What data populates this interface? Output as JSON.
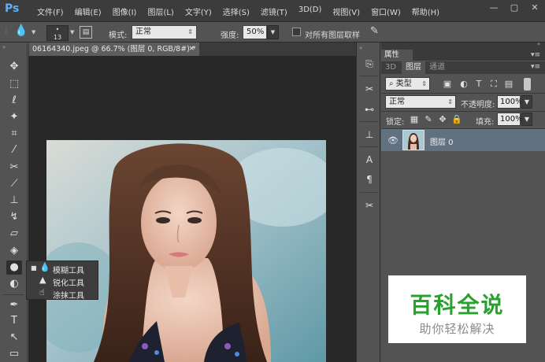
{
  "app": {
    "logo": "Ps"
  },
  "menu": [
    "文件(F)",
    "编辑(E)",
    "图像(I)",
    "图层(L)",
    "文字(Y)",
    "选择(S)",
    "滤镜(T)",
    "3D(D)",
    "视图(V)",
    "窗口(W)",
    "帮助(H)"
  ],
  "window_controls": {
    "minimize": "—",
    "restore": "▢",
    "close": "✕"
  },
  "options": {
    "brush_size": "13",
    "mode_label": "模式:",
    "mode_value": "正常",
    "strength_label": "强度:",
    "strength_value": "50%",
    "sample_all_label": "对所有图层取样"
  },
  "document": {
    "tab_title": "06164340.jpeg @ 66.7% (图层 0, RGB/8#) *",
    "close": "×"
  },
  "flyout": {
    "items": [
      {
        "label": "模糊工具",
        "icon": "blur-drop-icon",
        "selected": true
      },
      {
        "label": "锐化工具",
        "icon": "sharpen-triangle-icon",
        "selected": false
      },
      {
        "label": "涂抹工具",
        "icon": "smudge-finger-icon",
        "selected": false
      }
    ]
  },
  "panels": {
    "properties_tab": "属性",
    "tabs": [
      "3D",
      "图层",
      "通道"
    ],
    "active_tab": "图层",
    "filter_kind": "类型",
    "blend_mode": "正常",
    "opacity_label": "不透明度:",
    "opacity_value": "100%",
    "lock_label": "锁定:",
    "fill_label": "填充:",
    "fill_value": "100%",
    "layer_name": "图层 0"
  },
  "watermark": {
    "title": "百科全说",
    "subtitle": "助你轻松解决",
    "color": "#27a22d"
  },
  "colors": {
    "menubar": "#3c3c3c",
    "panel": "#535353",
    "canvas_bg": "#282828",
    "selected_layer": "#617180",
    "ps_blue": "#5ab0ff"
  }
}
